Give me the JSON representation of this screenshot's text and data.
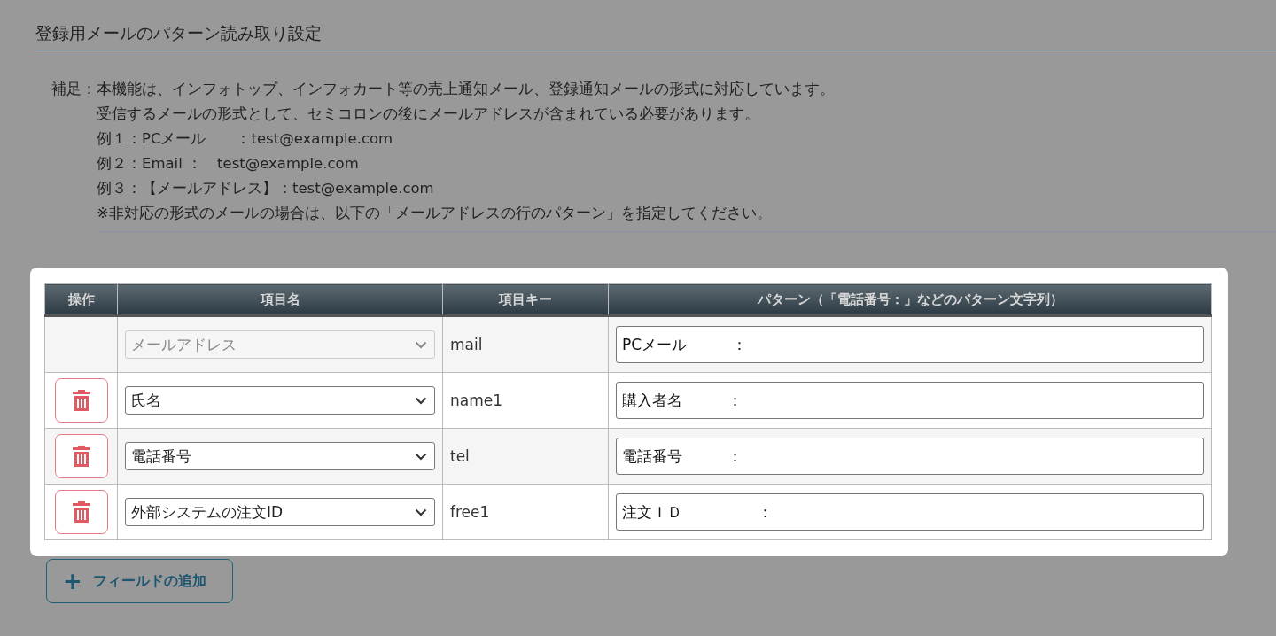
{
  "section_title": "登録用メールのパターン読み取り設定",
  "note": {
    "label": "補足：",
    "lines": [
      "本機能は、インフォトップ、インフォカート等の売上通知メール、登録通知メールの形式に対応しています。",
      "受信するメールの形式として、セミコロンの後にメールアドレスが含まれている必要があります。",
      "例１：PCメール　　：test@example.com",
      "例２：Email ：　test@example.com",
      "例３：【メールアドレス】：test@example.com",
      "※非対応の形式のメールの場合は、以下の「メールアドレスの行のパターン」を指定してください。"
    ]
  },
  "table": {
    "columns": [
      "操作",
      "項目名",
      "項目キー",
      "パターン（「電話番号：」などのパターン文字列）"
    ],
    "rows": [
      {
        "deletable": false,
        "item_name": "メールアドレス",
        "disabled": true,
        "key": "mail",
        "pattern": "PCメール　　　："
      },
      {
        "deletable": true,
        "item_name": "氏名",
        "disabled": false,
        "key": "name1",
        "pattern": "購入者名　　　："
      },
      {
        "deletable": true,
        "item_name": "電話番号",
        "disabled": false,
        "key": "tel",
        "pattern": "電話番号　　　："
      },
      {
        "deletable": true,
        "item_name": "外部システムの注文ID",
        "disabled": false,
        "key": "free1",
        "pattern": "注文ＩＤ　　　　　："
      }
    ]
  },
  "add_button": {
    "icon": "+",
    "label": "フィールドの追加"
  }
}
